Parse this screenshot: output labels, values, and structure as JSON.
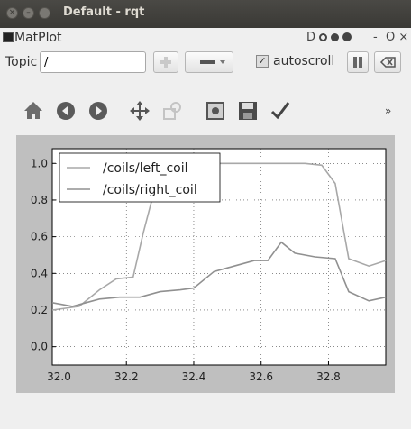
{
  "window": {
    "title": "Default - rqt",
    "close_glyph": "×",
    "minimize_glyph": "–"
  },
  "plugin": {
    "title": "MatPlot",
    "controls_label": "D",
    "minimize_label": "- ",
    "close_label": "O ×"
  },
  "toolbar": {
    "topic_label": "Topic",
    "topic_value": "/",
    "autoscroll_label": "autoscroll",
    "autoscroll_checked": true
  },
  "mpl_toolbar": {
    "icons": [
      "home-icon",
      "back-icon",
      "forward-icon",
      "pan-icon",
      "zoom-icon",
      "subplots-icon",
      "save-icon",
      "edit-icon"
    ],
    "overflow_label": "»"
  },
  "chart_data": {
    "type": "line",
    "title": "",
    "xlabel": "",
    "ylabel": "",
    "xlim": [
      31.98,
      32.97
    ],
    "ylim": [
      -0.1,
      1.08
    ],
    "xticks": [
      32.0,
      32.2,
      32.4,
      32.6,
      32.8
    ],
    "xtick_labels": [
      "32.0",
      "32.2",
      "32.4",
      "32.6",
      "32.8"
    ],
    "yticks": [
      0.0,
      0.2,
      0.4,
      0.6,
      0.8,
      1.0
    ],
    "ytick_labels": [
      "0.0",
      "0.2",
      "0.4",
      "0.6",
      "0.8",
      "1.0"
    ],
    "grid": true,
    "legend_position": "top-left",
    "colors": {
      "left": "#a8a8a8",
      "right": "#909090"
    },
    "series": [
      {
        "name": "/coils/left_coil",
        "x": [
          31.98,
          32.06,
          32.12,
          32.17,
          32.22,
          32.25,
          32.28,
          32.32,
          32.38,
          32.45,
          32.52,
          32.58,
          32.66,
          32.73,
          32.78,
          32.82,
          32.86,
          32.92,
          32.97
        ],
        "y": [
          0.2,
          0.22,
          0.31,
          0.37,
          0.38,
          0.62,
          0.83,
          0.98,
          1.0,
          1.0,
          1.0,
          1.0,
          1.0,
          1.0,
          0.99,
          0.89,
          0.48,
          0.44,
          0.47
        ]
      },
      {
        "name": "/coils/right_coil",
        "x": [
          31.98,
          32.04,
          32.12,
          32.18,
          32.24,
          32.3,
          32.36,
          32.4,
          32.46,
          32.52,
          32.58,
          32.62,
          32.66,
          32.7,
          32.76,
          32.82,
          32.86,
          32.92,
          32.97
        ],
        "y": [
          0.24,
          0.22,
          0.26,
          0.27,
          0.27,
          0.3,
          0.31,
          0.32,
          0.41,
          0.44,
          0.47,
          0.47,
          0.57,
          0.51,
          0.49,
          0.48,
          0.3,
          0.25,
          0.27
        ]
      }
    ]
  }
}
